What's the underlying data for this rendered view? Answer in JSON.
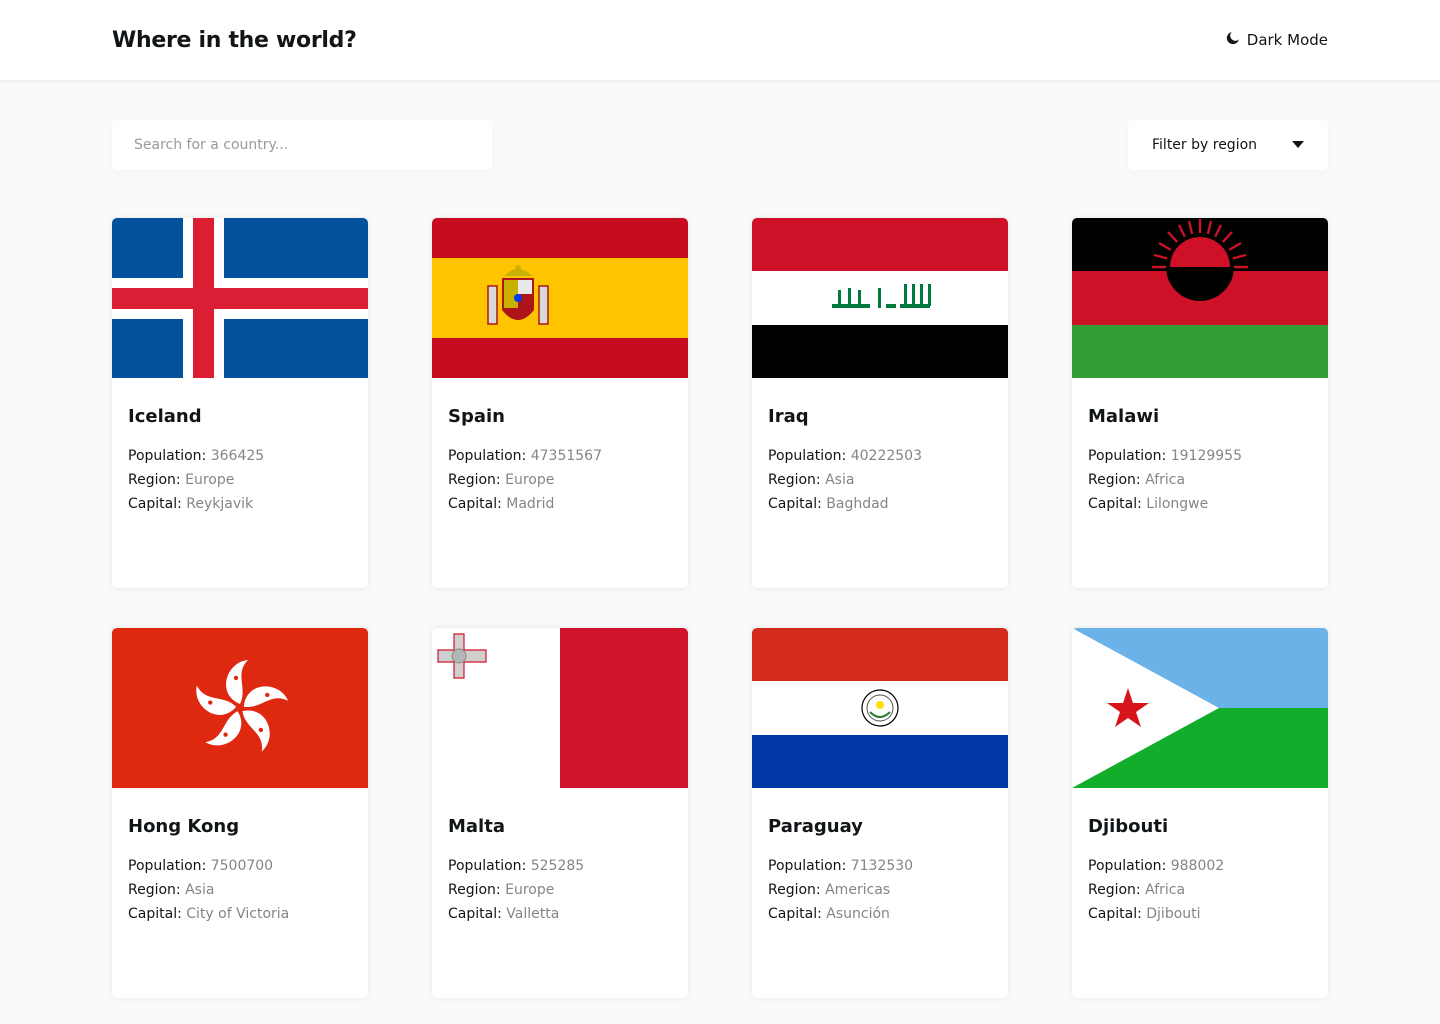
{
  "header": {
    "title": "Where in the world?",
    "dark_mode_label": "Dark Mode"
  },
  "search": {
    "placeholder": "Search for a country...",
    "value": ""
  },
  "filter": {
    "label": "Filter by region"
  },
  "labels": {
    "population": "Population:",
    "region": "Region:",
    "capital": "Capital:"
  },
  "countries": [
    {
      "name": "Iceland",
      "population": "366425",
      "region": "Europe",
      "capital": "Reykjavik"
    },
    {
      "name": "Spain",
      "population": "47351567",
      "region": "Europe",
      "capital": "Madrid"
    },
    {
      "name": "Iraq",
      "population": "40222503",
      "region": "Asia",
      "capital": "Baghdad"
    },
    {
      "name": "Malawi",
      "population": "19129955",
      "region": "Africa",
      "capital": "Lilongwe"
    },
    {
      "name": "Hong Kong",
      "population": "7500700",
      "region": "Asia",
      "capital": "City of Victoria"
    },
    {
      "name": "Malta",
      "population": "525285",
      "region": "Europe",
      "capital": "Valletta"
    },
    {
      "name": "Paraguay",
      "population": "7132530",
      "region": "Americas",
      "capital": "Asunción"
    },
    {
      "name": "Djibouti",
      "population": "988002",
      "region": "Africa",
      "capital": "Djibouti"
    }
  ],
  "colors": {
    "background": "#fafafa",
    "text": "#111517",
    "muted": "#858585"
  }
}
